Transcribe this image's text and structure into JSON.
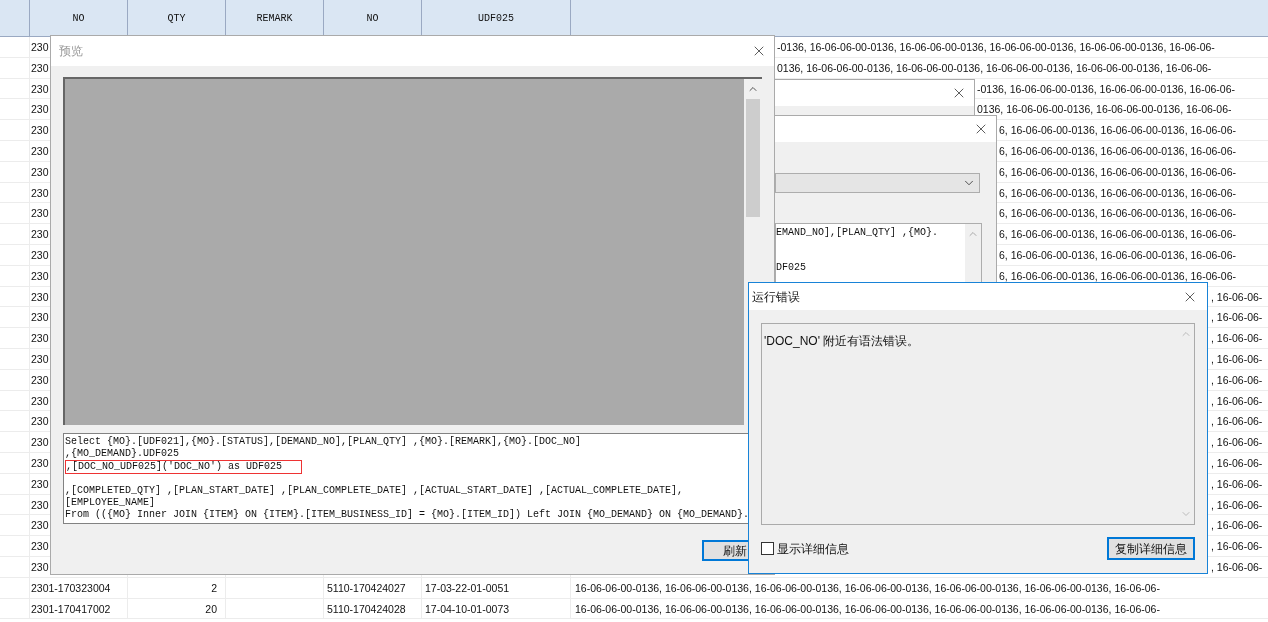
{
  "table": {
    "columns": [
      "NO",
      "QTY",
      "REMARK",
      "NO",
      "UDF025"
    ],
    "rows": [
      {
        "no": "230",
        "column_7": "-0136, 16-06-06-00-0136, 16-06-06-00-0136, 16-06-06-00-0136, 16-06-06-00-0136, 16-06-06-"
      },
      {
        "no": "230",
        "column_7": "0136, 16-06-06-00-0136, 16-06-06-00-0136, 16-06-06-00-0136, 16-06-06-00-0136, 16-06-06-"
      },
      {
        "no": "230",
        "column_7": "-0136, 16-06-06-00-0136, 16-06-06-00-0136, 16-06-06-"
      },
      {
        "no": "230",
        "column_7": "0136, 16-06-06-00-0136, 16-06-06-00-0136, 16-06-06-"
      },
      {
        "no": "230",
        "column_7": "6, 16-06-06-00-0136, 16-06-06-00-0136, 16-06-06-"
      },
      {
        "no": "230",
        "column_7": "6, 16-06-06-00-0136, 16-06-06-00-0136, 16-06-06-"
      },
      {
        "no": "230",
        "column_7": "6, 16-06-06-00-0136, 16-06-06-00-0136, 16-06-06-"
      },
      {
        "no": "230",
        "column_7": "6, 16-06-06-00-0136, 16-06-06-00-0136, 16-06-06-"
      },
      {
        "no": "230",
        "column_7": "6, 16-06-06-00-0136, 16-06-06-00-0136, 16-06-06-"
      },
      {
        "no": "230",
        "column_7": "6, 16-06-06-00-0136, 16-06-06-00-0136, 16-06-06-"
      },
      {
        "no": "230",
        "column_7": "6, 16-06-06-00-0136, 16-06-06-00-0136, 16-06-06-"
      },
      {
        "no": "230",
        "column_7": "6, 16-06-06-00-0136, 16-06-06-00-0136, 16-06-06-"
      },
      {
        "no": "230",
        "column_7": ", 16-06-06-"
      },
      {
        "no": "230",
        "column_7": ", 16-06-06-"
      },
      {
        "no": "230",
        "column_7": ", 16-06-06-"
      },
      {
        "no": "230",
        "column_7": ", 16-06-06-"
      },
      {
        "no": "230",
        "column_7": ", 16-06-06-"
      },
      {
        "no": "230",
        "column_7": ", 16-06-06-"
      },
      {
        "no": "230",
        "column_7": ", 16-06-06-"
      },
      {
        "no": "230",
        "column_7": ", 16-06-06-"
      },
      {
        "no": "230",
        "column_7": ", 16-06-06-"
      },
      {
        "no": "230",
        "column_7": ", 16-06-06-"
      },
      {
        "no": "230",
        "column_7": ", 16-06-06-"
      },
      {
        "no": "230",
        "column_7": ", 16-06-06-"
      },
      {
        "no": "230",
        "column_7": ", 16-06-06-"
      },
      {
        "no": "230",
        "column_7": ", 16-06-06-"
      },
      {
        "no": "2301-170323004",
        "qty": "2",
        "no_2": "5110-170424027",
        "udf025": "17-03-22-01-0051",
        "column_7": "16-06-06-00-0136, 16-06-06-00-0136, 16-06-06-00-0136, 16-06-06-00-0136, 16-06-06-00-0136, 16-06-06-00-0136, 16-06-06-"
      },
      {
        "no": "2301-170417002",
        "qty": "20",
        "no_2": "5110-170424028",
        "udf025": "17-04-10-01-0073",
        "column_7": "16-06-06-00-0136, 16-06-06-00-0136, 16-06-06-00-0136, 16-06-06-00-0136, 16-06-06-00-0136, 16-06-06-00-0136, 16-06-06-"
      }
    ]
  },
  "query_dialog": {
    "sql_lines": [
      "EMAND_NO],[PLAN_QTY] ,{MO}.",
      "DF025"
    ]
  },
  "preview_dialog": {
    "title": "预览",
    "active": false,
    "sql_lines": [
      {
        "text": "Select {MO}.[UDF021],{MO}.[STATUS],[DEMAND_NO],[PLAN_QTY] ,{MO}.[REMARK],{MO}.[DOC_NO]",
        "highlighted": false
      },
      {
        "text": ",{MO_DEMAND}.UDF025",
        "highlighted": false
      },
      {
        "text": ",[DOC_NO_UDF025]('DOC_NO') as UDF025",
        "highlighted": true
      },
      {
        "text": ",[COMPLETED_QTY] ,[PLAN_START_DATE] ,[PLAN_COMPLETE_DATE] ,[ACTUAL_START_DATE] ,[ACTUAL_COMPLETE_DATE],",
        "highlighted": false
      },
      {
        "text": "[EMPLOYEE_NAME]",
        "highlighted": false
      },
      {
        "text": "From (({MO} Inner JOIN {ITEM} ON {ITEM}.[ITEM_BUSINESS_ID] = {MO}.[ITEM_ID]) Left JOIN {MO_DEMAND} ON {MO_DEMAND}.",
        "highlighted": false
      }
    ],
    "refresh_button": "刷新"
  },
  "error_dialog": {
    "title": "运行错误",
    "active": true,
    "message": "'DOC_NO' 附近有语法错误。",
    "show_details": {
      "label": "显示详细信息",
      "checked": false
    },
    "copy_button": "复制详细信息"
  }
}
